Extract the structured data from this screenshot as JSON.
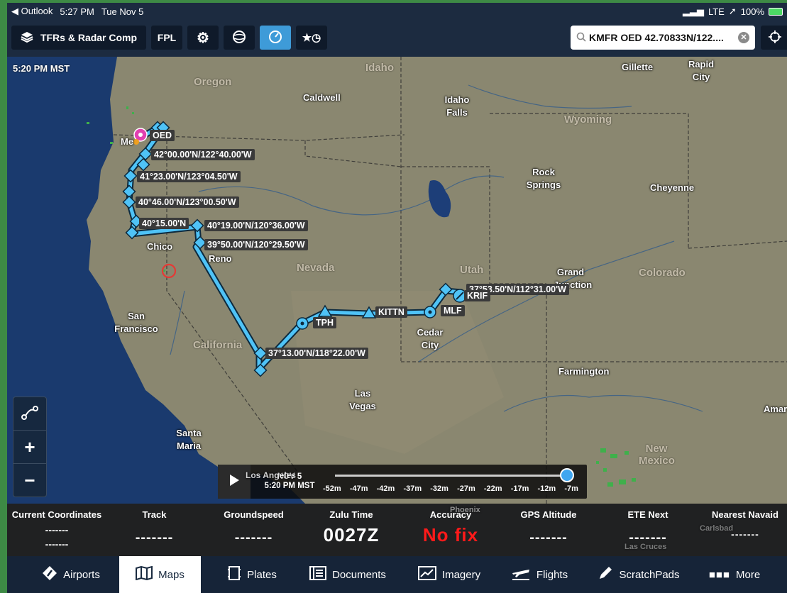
{
  "status_bar": {
    "back_app": "◀ Outlook",
    "time": "5:27 PM",
    "date": "Tue Nov 5",
    "network": "LTE",
    "battery": "100%"
  },
  "toolbar": {
    "layer_button": "TFRs & Radar Comp",
    "fpl_button": "FPL",
    "search_value": "KMFR OED 42.70833N/122...."
  },
  "map": {
    "time_label": "5:20 PM MST",
    "states": [
      "Oregon",
      "Idaho",
      "Wyoming",
      "Nevada",
      "Utah",
      "Colorado",
      "California",
      "New Mexico"
    ],
    "cities": {
      "gillette": "Gillette",
      "rapid_city": "Rapid City",
      "caldwell": "Caldwell",
      "idaho_falls": "Idaho Falls",
      "rock_springs": "Rock Springs",
      "cheyenne": "Cheyenne",
      "chico": "Chico",
      "reno": "Reno",
      "grand_junction": "Grand Junction",
      "san_francisco": "San Francisco",
      "cedar_city": "Cedar City",
      "farmington": "Farmington",
      "las_vegas": "Las Vegas",
      "santa_maria": "Santa Maria",
      "los_angeles": "Los Angeles",
      "phoenix": "Phoenix",
      "carlsbad": "Carlsbad",
      "las_cruces": "Las Cruces",
      "amarillo": "Amar",
      "medford": "Me"
    },
    "waypoints": {
      "oed": "OED",
      "wp1": "42°00.00'N/122°40.00'W",
      "wp2": "41°23.00'N/123°04.50'W",
      "wp3": "40°46.00'N/123°00.50'W",
      "wp4": "40°15.00'N",
      "wp5": "40°19.00'N/120°36.00'W",
      "wp6": "39°50.00'N/120°29.50'W",
      "wp7": "37°13.00'N/118°22.00'W",
      "tph": "TPH",
      "kittn": "KITTN",
      "mlf": "MLF",
      "wp8": "37°53.50'N/112°31.00'W",
      "krif": "KRIF"
    }
  },
  "timeline": {
    "date": "NOV 5",
    "time": "5:20 PM MST",
    "ticks": [
      "-52m",
      "-47m",
      "-42m",
      "-37m",
      "-32m",
      "-27m",
      "-22m",
      "-17m",
      "-12m",
      "-7m"
    ]
  },
  "info": [
    {
      "label": "Current Coordinates",
      "value": "-------",
      "value2": "-------"
    },
    {
      "label": "Track",
      "value": "-------"
    },
    {
      "label": "Groundspeed",
      "value": "-------"
    },
    {
      "label": "Zulu Time",
      "value": "0027Z"
    },
    {
      "label": "Accuracy",
      "value": "No fix"
    },
    {
      "label": "GPS Altitude",
      "value": "-------"
    },
    {
      "label": "ETE Next",
      "value": "-------"
    },
    {
      "label": "Nearest Navaid",
      "value": "-------"
    }
  ],
  "tabs": [
    {
      "label": "Airports"
    },
    {
      "label": "Maps"
    },
    {
      "label": "Plates"
    },
    {
      "label": "Documents"
    },
    {
      "label": "Imagery"
    },
    {
      "label": "Flights"
    },
    {
      "label": "ScratchPads"
    },
    {
      "label": "More"
    }
  ],
  "colors": {
    "route": "#4fc3f7",
    "active_tab_bg": "#ffffff",
    "no_fix": "#ff1a1a",
    "toolbar_active": "#3e9bd8"
  }
}
